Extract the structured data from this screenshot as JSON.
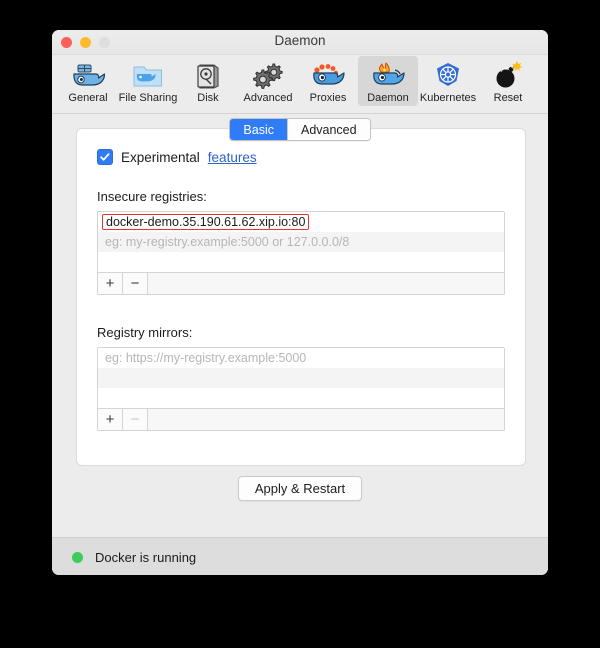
{
  "window": {
    "title": "Daemon",
    "traffic_lights": [
      "close",
      "minimize",
      "zoom"
    ]
  },
  "toolbar": {
    "items": [
      {
        "label": "General",
        "icon": "docker-whale-icon",
        "selected": false
      },
      {
        "label": "File Sharing",
        "icon": "folder-whale-icon",
        "selected": false
      },
      {
        "label": "Disk",
        "icon": "hard-disk-icon",
        "selected": false
      },
      {
        "label": "Advanced",
        "icon": "gears-icon",
        "selected": false
      },
      {
        "label": "Proxies",
        "icon": "whale-headband-icon",
        "selected": false
      },
      {
        "label": "Daemon",
        "icon": "whale-flame-icon",
        "selected": true
      },
      {
        "label": "Kubernetes",
        "icon": "kubernetes-helm-icon",
        "selected": false
      }
    ],
    "reset": {
      "label": "Reset",
      "icon": "bomb-icon"
    }
  },
  "tabs": {
    "items": [
      {
        "label": "Basic",
        "active": true
      },
      {
        "label": "Advanced",
        "active": false
      }
    ]
  },
  "experimental": {
    "checked": true,
    "label": "Experimental",
    "link_label": "features"
  },
  "insecure_registries": {
    "label": "Insecure registries:",
    "rows": [
      {
        "text": "docker-demo.35.190.61.62.xip.io:80",
        "kind": "value",
        "invalid": true
      },
      {
        "text": "eg: my-registry.example:5000 or 127.0.0.0/8",
        "kind": "placeholder",
        "invalid": false
      },
      {
        "text": "",
        "kind": "empty",
        "invalid": false
      }
    ],
    "add_label": "+",
    "remove_label": "−",
    "add_enabled": true,
    "remove_enabled": true
  },
  "registry_mirrors": {
    "label": "Registry mirrors:",
    "rows": [
      {
        "text": "eg: https://my-registry.example:5000",
        "kind": "placeholder",
        "invalid": false
      },
      {
        "text": "",
        "kind": "empty",
        "invalid": false
      },
      {
        "text": "",
        "kind": "empty",
        "invalid": false
      }
    ],
    "add_label": "+",
    "remove_label": "−",
    "add_enabled": true,
    "remove_enabled": false
  },
  "apply": {
    "label": "Apply & Restart"
  },
  "status": {
    "text": "Docker is running",
    "indicator_color": "#3ecc5f"
  },
  "colors": {
    "accent": "#2f7cf6",
    "error": "#e8332f",
    "link": "#2f63c8",
    "status_ok": "#3ecc5f",
    "toolbar_bg": "#ececec",
    "statusbar_bg": "#dddddd",
    "panel_bg": "#ffffff"
  }
}
